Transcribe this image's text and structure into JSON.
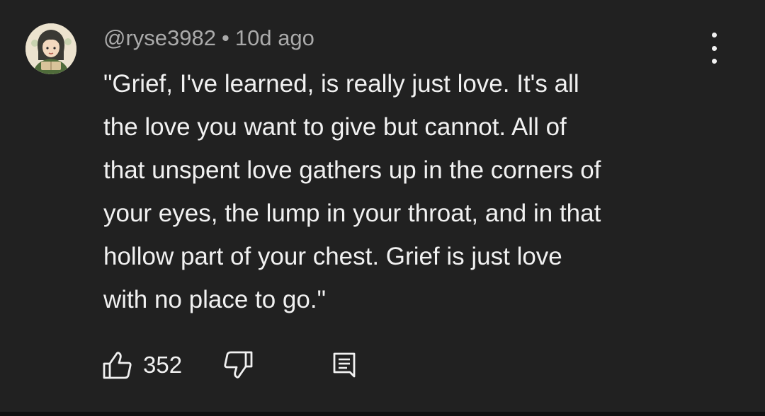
{
  "comment": {
    "author": "@ryse3982",
    "separator": "•",
    "timestamp": "10d ago",
    "text": "\"Grief, I've learned, is really just love. It's all\nthe love you want to give but cannot. All of\nthat unspent love gathers up in the corners of\nyour eyes, the lump in your throat, and in that\nhollow part of your chest. Grief is just love\nwith no place to go.\""
  },
  "actions": {
    "like_count": "352",
    "like_icon": "thumbs-up-icon",
    "dislike_icon": "thumbs-down-icon",
    "reply_icon": "comment-icon",
    "menu_icon": "more-vertical-icon"
  },
  "colors": {
    "background": "#212121",
    "text_primary": "#f1f1f1",
    "text_secondary": "#aaaaaa"
  }
}
